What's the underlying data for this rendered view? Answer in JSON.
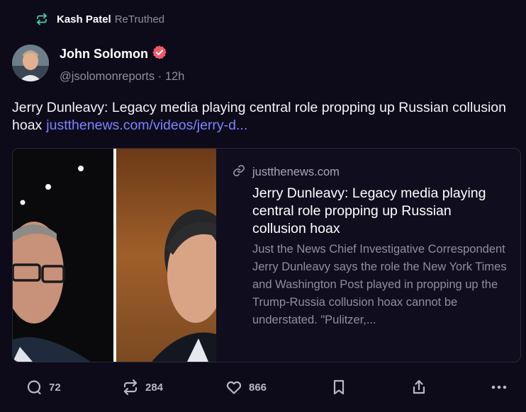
{
  "retruth": {
    "name": "Kash Patel",
    "label": "ReTruthed",
    "icon": "retruth-icon",
    "icon_color": "#3fd1a3"
  },
  "author": {
    "name": "John Solomon",
    "verified_icon": "verified-badge-icon",
    "verified_color": "#ef5a6b",
    "handle": "@jsolomonreports",
    "time": "12h"
  },
  "post": {
    "text": "Jerry Dunleavy: Legacy media playing central role propping up Russian collusion hoax",
    "link": "justthenews.com/videos/jerry-d...",
    "link_color": "#7c84ff"
  },
  "card": {
    "domain": "justthenews.com",
    "domain_icon": "link-icon",
    "title": "Jerry Dunleavy: Legacy media playing central role propping up Russian collusion hoax",
    "description": "Just the News Chief Investigative Correspondent Jerry Dunleavy says the role the New York Times and Washington Post played in propping up the Trump-Russia collusion hoax cannot be understated. \"Pulitzer,..."
  },
  "actions": {
    "replies": {
      "icon": "reply-icon",
      "count": "72"
    },
    "retruths": {
      "icon": "retruth-icon",
      "count": "284"
    },
    "likes": {
      "icon": "heart-icon",
      "count": "866"
    },
    "bookmark": {
      "icon": "bookmark-icon"
    },
    "share": {
      "icon": "share-icon"
    },
    "more": {
      "icon": "more-icon"
    }
  }
}
